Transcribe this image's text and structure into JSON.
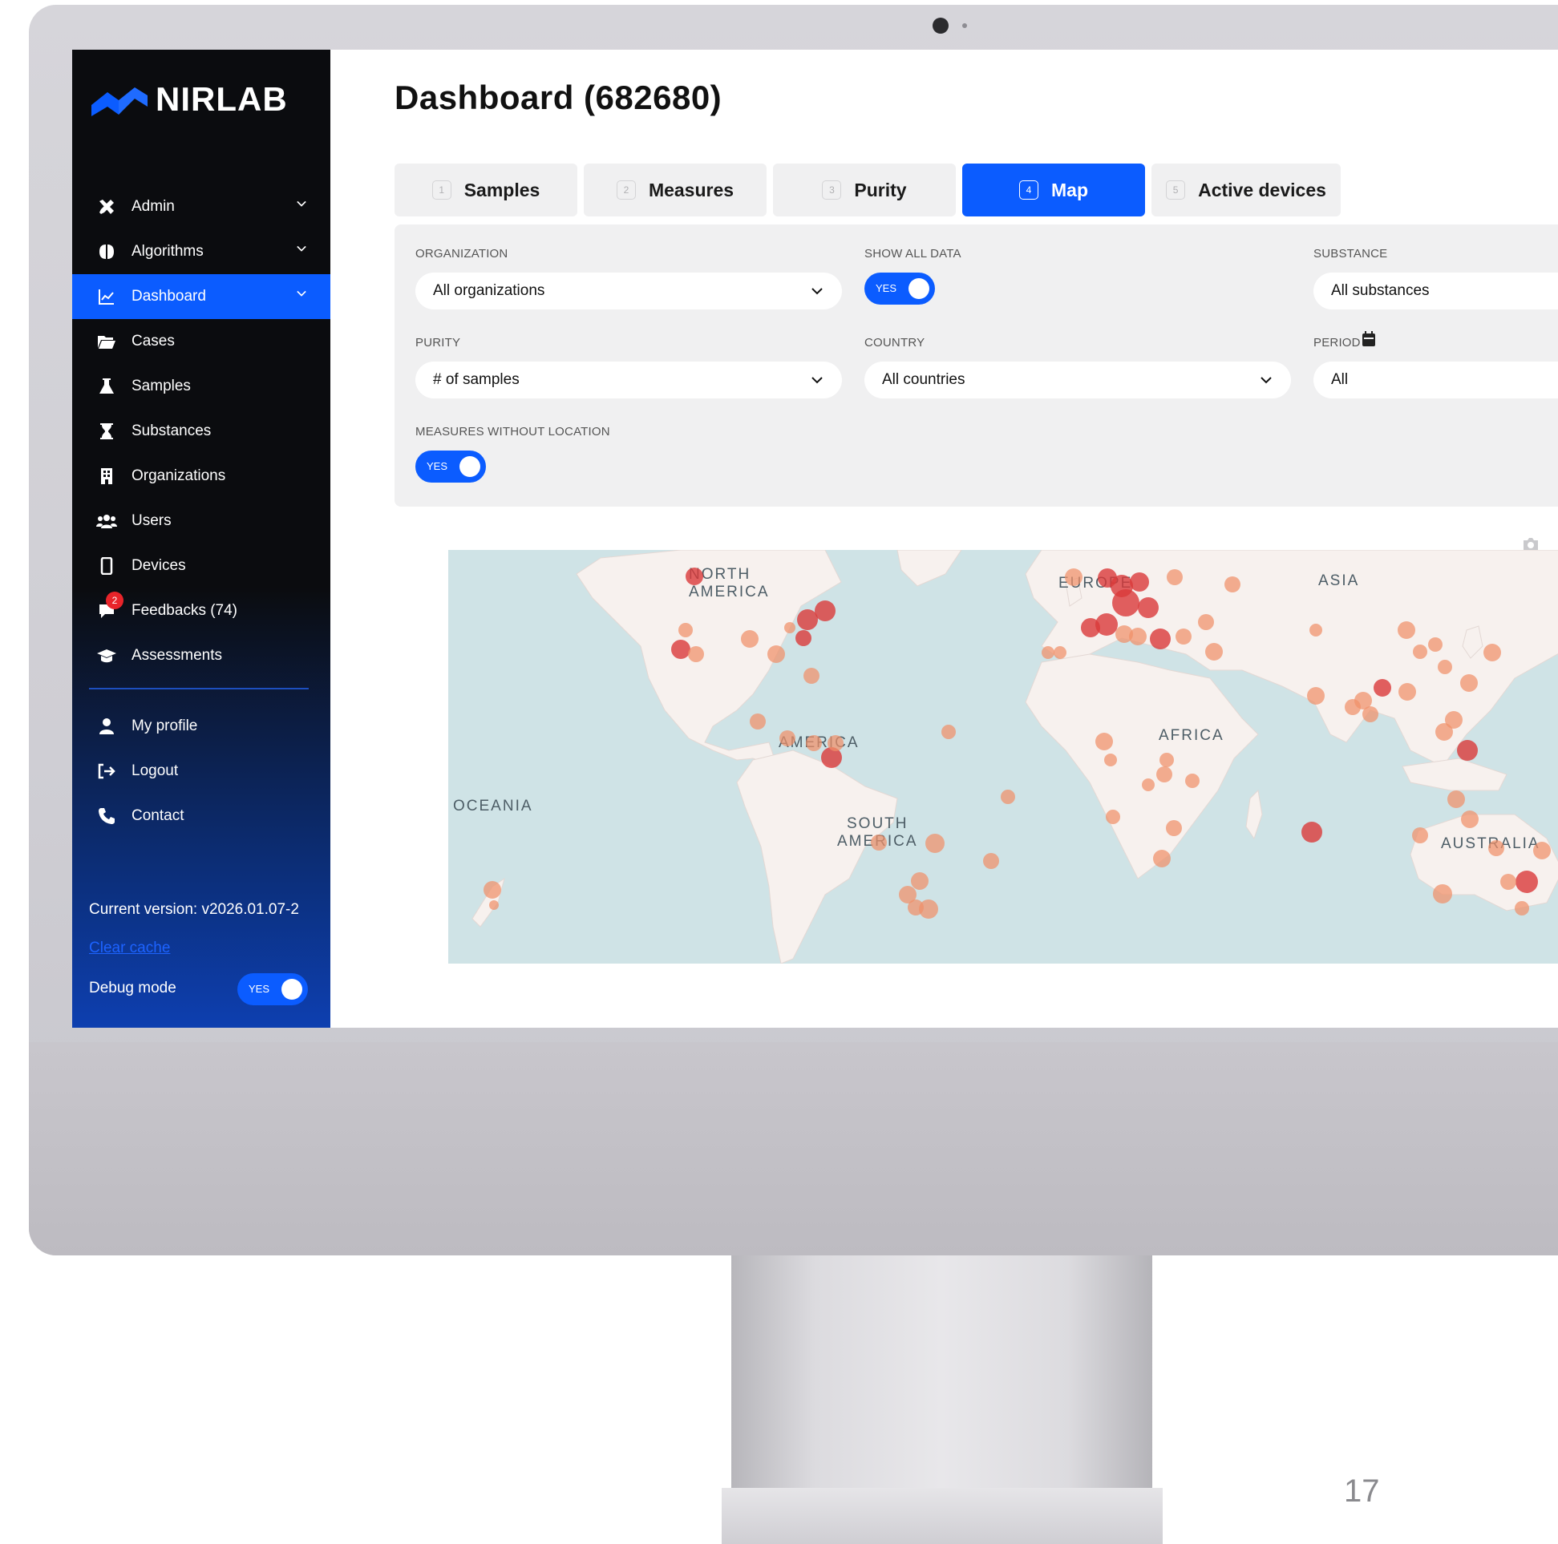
{
  "window": {
    "page_number": "17"
  },
  "brand": {
    "name": "NIRLAB",
    "color": "#0b5cff"
  },
  "sidebar": {
    "items": [
      {
        "label": "Admin",
        "icon": "tools-icon",
        "has_chevron": true
      },
      {
        "label": "Algorithms",
        "icon": "brain-icon",
        "has_chevron": true
      },
      {
        "label": "Dashboard",
        "icon": "chart-line-icon",
        "has_chevron": true,
        "active": true
      },
      {
        "label": "Cases",
        "icon": "folder-open-icon"
      },
      {
        "label": "Samples",
        "icon": "flask-icon"
      },
      {
        "label": "Substances",
        "icon": "hourglass-icon"
      },
      {
        "label": "Organizations",
        "icon": "building-icon"
      },
      {
        "label": "Users",
        "icon": "users-icon"
      },
      {
        "label": "Devices",
        "icon": "mobile-icon"
      },
      {
        "label": "Feedbacks (74)",
        "icon": "comment-icon",
        "badge": "2"
      },
      {
        "label": "Assessments",
        "icon": "graduation-cap-icon"
      }
    ],
    "secondary_items": [
      {
        "label": "My profile",
        "icon": "user-icon"
      },
      {
        "label": "Logout",
        "icon": "logout-icon"
      },
      {
        "label": "Contact",
        "icon": "phone-icon"
      }
    ],
    "version": "Current version: v2026.01.07-2",
    "clear_cache": "Clear cache",
    "debug_mode": {
      "label": "Debug mode",
      "value": "YES"
    }
  },
  "main": {
    "title": "Dashboard (682680)",
    "tabs": [
      {
        "num": "1",
        "label": "Samples"
      },
      {
        "num": "2",
        "label": "Measures"
      },
      {
        "num": "3",
        "label": "Purity"
      },
      {
        "num": "4",
        "label": "Map",
        "active": true
      },
      {
        "num": "5",
        "label": "Active devices"
      }
    ],
    "filters": {
      "organization": {
        "label": "ORGANIZATION",
        "value": "All organizations"
      },
      "show_all_data": {
        "label": "SHOW ALL DATA",
        "value": "YES"
      },
      "substance": {
        "label": "SUBSTANCE",
        "value": "All substances"
      },
      "purity": {
        "label": "PURITY",
        "value": "# of samples"
      },
      "country": {
        "label": "COUNTRY",
        "value": "All countries"
      },
      "period": {
        "label": "PERIOD",
        "value": "All"
      },
      "measures_without_location": {
        "label": "MEASURES WITHOUT LOCATION",
        "value": "YES"
      }
    },
    "map": {
      "labels": {
        "north_america_1": "NORTH",
        "north_america_2": "AMERICA",
        "america": "AMERICA",
        "south_america_1": "SOUTH",
        "south_america_2": "AMERICA",
        "europe": "EUROPE",
        "asia": "ASIA",
        "africa": "AFRICA",
        "oceania": "OCEANIA",
        "australia": "AUSTRALIA"
      },
      "colors": {
        "water": "#cfe3e6",
        "land": "#f7f1ee",
        "marker_high": "#d93a3a",
        "marker_low": "#f0906a"
      }
    }
  }
}
